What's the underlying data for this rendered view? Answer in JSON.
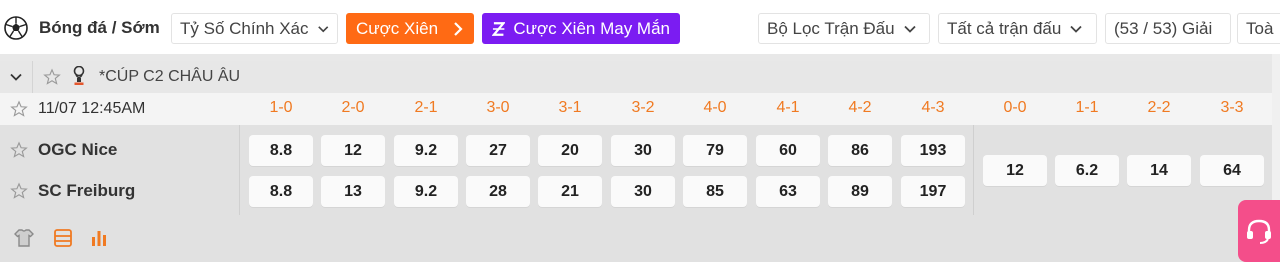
{
  "header": {
    "title": "Bóng đá / Sớm",
    "market_select": "Tỷ Số Chính Xác",
    "parlay_button": "Cược Xiên",
    "lucky_parlay_button": "Cược Xiên May Mắn",
    "match_filter": "Bộ Lọc Trận Đấu",
    "all_matches": "Tất cả trận đấu",
    "league_count": "(53 / 53) Giải",
    "truncated_tab": "Toà"
  },
  "league": {
    "name": "*CÚP C2 CHÂU ÂU"
  },
  "match": {
    "datetime": "11/07 12:45AM",
    "home": "OGC Nice",
    "away": "SC Freiburg"
  },
  "score_columns": [
    "1-0",
    "2-0",
    "2-1",
    "3-0",
    "3-1",
    "3-2",
    "4-0",
    "4-1",
    "4-2",
    "4-3"
  ],
  "draw_columns": [
    "0-0",
    "1-1",
    "2-2",
    "3-3"
  ],
  "odds": {
    "home": [
      "8.8",
      "12",
      "9.2",
      "27",
      "20",
      "30",
      "79",
      "60",
      "86",
      "193"
    ],
    "away": [
      "8.8",
      "13",
      "9.2",
      "28",
      "21",
      "30",
      "85",
      "63",
      "89",
      "197"
    ],
    "draw": [
      "12",
      "6.2",
      "14",
      "64"
    ]
  },
  "icons": {
    "brand": "soccer-ball-icon",
    "stats": [
      "lineup-icon",
      "scoreboard-icon",
      "bar-chart-icon"
    ],
    "support": "headset-icon"
  },
  "colors": {
    "accent_orange": "#ff6a14",
    "accent_purple": "#7b1cf2",
    "score_label": "#f07a22",
    "support_pink": "#f44e8a"
  }
}
